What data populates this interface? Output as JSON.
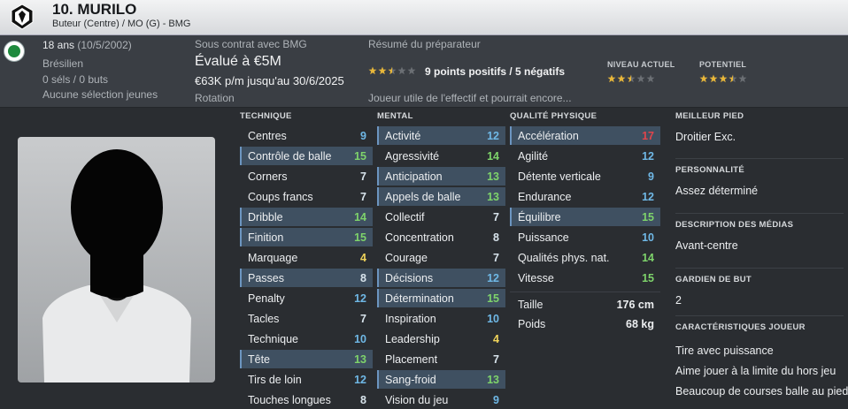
{
  "header": {
    "name": "10. MURILO",
    "position_line": "Buteur (Centre) / MO (G) - BMG"
  },
  "info": {
    "age": "18 ans",
    "dob": "(10/5/2002)",
    "nationality": "Brésilien",
    "goals": "0 séls / 0 buts",
    "youth": "Aucune sélection jeunes",
    "contract_label": "Sous contrat avec BMG",
    "value": "Évalué à €5M",
    "wage": "€63K p/m jusqu'au 30/6/2025",
    "role": "Rotation",
    "report_label": "Résumé du préparateur",
    "report_points": "9 points positifs / 5 négatifs",
    "report_stars": 2.5,
    "report_text": "Joueur utile de l'effectif et pourrait encore...",
    "current_label": "NIVEAU ACTUEL",
    "current_stars": 2.5,
    "potential_label": "POTENTIEL",
    "potential_stars": 3.5
  },
  "colors": {
    "highlight": "#3f5061",
    "attr_default": "#6fb8e6",
    "star_gold": "#e7b63a"
  },
  "technique": {
    "title": "TECHNIQUE",
    "rows": [
      {
        "n": "Centres",
        "v": "9",
        "hl": false
      },
      {
        "n": "Contrôle de balle",
        "v": "15",
        "hl": true
      },
      {
        "n": "Corners",
        "v": "7",
        "hl": false
      },
      {
        "n": "Coups francs",
        "v": "7",
        "hl": false
      },
      {
        "n": "Dribble",
        "v": "14",
        "hl": true
      },
      {
        "n": "Finition",
        "v": "15",
        "hl": true
      },
      {
        "n": "Marquage",
        "v": "4",
        "hl": false
      },
      {
        "n": "Passes",
        "v": "8",
        "hl": true
      },
      {
        "n": "Penalty",
        "v": "12",
        "hl": false
      },
      {
        "n": "Tacles",
        "v": "7",
        "hl": false
      },
      {
        "n": "Technique",
        "v": "10",
        "hl": false
      },
      {
        "n": "Tête",
        "v": "13",
        "hl": true
      },
      {
        "n": "Tirs de loin",
        "v": "12",
        "hl": false
      },
      {
        "n": "Touches longues",
        "v": "8",
        "hl": false
      }
    ]
  },
  "mental": {
    "title": "MENTAL",
    "rows": [
      {
        "n": "Activité",
        "v": "12",
        "hl": true
      },
      {
        "n": "Agressivité",
        "v": "14",
        "hl": false
      },
      {
        "n": "Anticipation",
        "v": "13",
        "hl": true
      },
      {
        "n": "Appels de balle",
        "v": "13",
        "hl": true
      },
      {
        "n": "Collectif",
        "v": "7",
        "hl": false
      },
      {
        "n": "Concentration",
        "v": "8",
        "hl": false
      },
      {
        "n": "Courage",
        "v": "7",
        "hl": false
      },
      {
        "n": "Décisions",
        "v": "12",
        "hl": true
      },
      {
        "n": "Détermination",
        "v": "15",
        "hl": true
      },
      {
        "n": "Inspiration",
        "v": "10",
        "hl": false
      },
      {
        "n": "Leadership",
        "v": "4",
        "hl": false
      },
      {
        "n": "Placement",
        "v": "7",
        "hl": false
      },
      {
        "n": "Sang-froid",
        "v": "13",
        "hl": true
      },
      {
        "n": "Vision du jeu",
        "v": "9",
        "hl": false
      }
    ]
  },
  "physical": {
    "title": "QUALITÉ PHYSIQUE",
    "rows": [
      {
        "n": "Accélération",
        "v": "17",
        "hl": true
      },
      {
        "n": "Agilité",
        "v": "12",
        "hl": false
      },
      {
        "n": "Détente verticale",
        "v": "9",
        "hl": false
      },
      {
        "n": "Endurance",
        "v": "12",
        "hl": false
      },
      {
        "n": "Équilibre",
        "v": "15",
        "hl": true
      },
      {
        "n": "Puissance",
        "v": "10",
        "hl": false
      },
      {
        "n": "Qualités phys. nat.",
        "v": "14",
        "hl": false
      },
      {
        "n": "Vitesse",
        "v": "15",
        "hl": false
      }
    ],
    "height_label": "Taille",
    "height": "176 cm",
    "weight_label": "Poids",
    "weight": "68 kg"
  },
  "right": [
    {
      "label": "MEILLEUR PIED",
      "values": [
        "Droitier Exc."
      ]
    },
    {
      "label": "PERSONNALITÉ",
      "values": [
        "Assez déterminé"
      ]
    },
    {
      "label": "DESCRIPTION DES MÉDIAS",
      "values": [
        "Avant-centre"
      ]
    },
    {
      "label": "GARDIEN DE BUT",
      "values": [
        "2"
      ]
    },
    {
      "label": "CARACTÉRISTIQUES JOUEUR",
      "values": [
        "Tire avec puissance",
        "Aime jouer à la limite du hors jeu",
        "Beaucoup de courses balle au pied"
      ]
    }
  ]
}
